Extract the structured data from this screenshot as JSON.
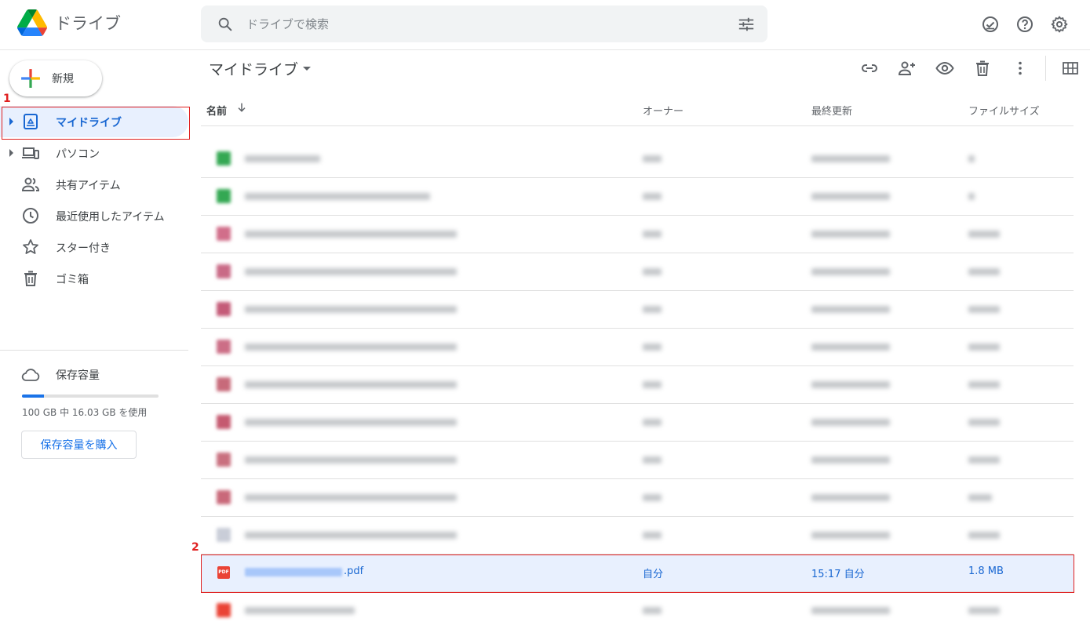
{
  "app": {
    "title": "ドライブ"
  },
  "search": {
    "placeholder": "ドライブで検索"
  },
  "sidebar": {
    "new_label": "新規",
    "items": [
      {
        "label": "マイドライブ"
      },
      {
        "label": "パソコン"
      },
      {
        "label": "共有アイテム"
      },
      {
        "label": "最近使用したアイテム"
      },
      {
        "label": "スター付き"
      },
      {
        "label": "ゴミ箱"
      }
    ],
    "storage": {
      "label": "保存容量",
      "usage_text": "100 GB 中 16.03 GB を使用",
      "used_fraction": 0.16,
      "buy_label": "保存容量を購入"
    }
  },
  "main": {
    "title": "マイドライブ",
    "columns": {
      "name": "名前",
      "owner": "オーナー",
      "modified": "最終更新",
      "size": "ファイルサイズ"
    },
    "selected_file": {
      "name_suffix": ".pdf",
      "owner": "自分",
      "modified": "15:17 自分",
      "size": "1.8 MB"
    }
  },
  "annotations": {
    "one": "1",
    "two": "2"
  },
  "colors": {
    "accent": "#1a73e8",
    "selected_bg": "#e8f0fe",
    "highlight": "#e02020"
  }
}
